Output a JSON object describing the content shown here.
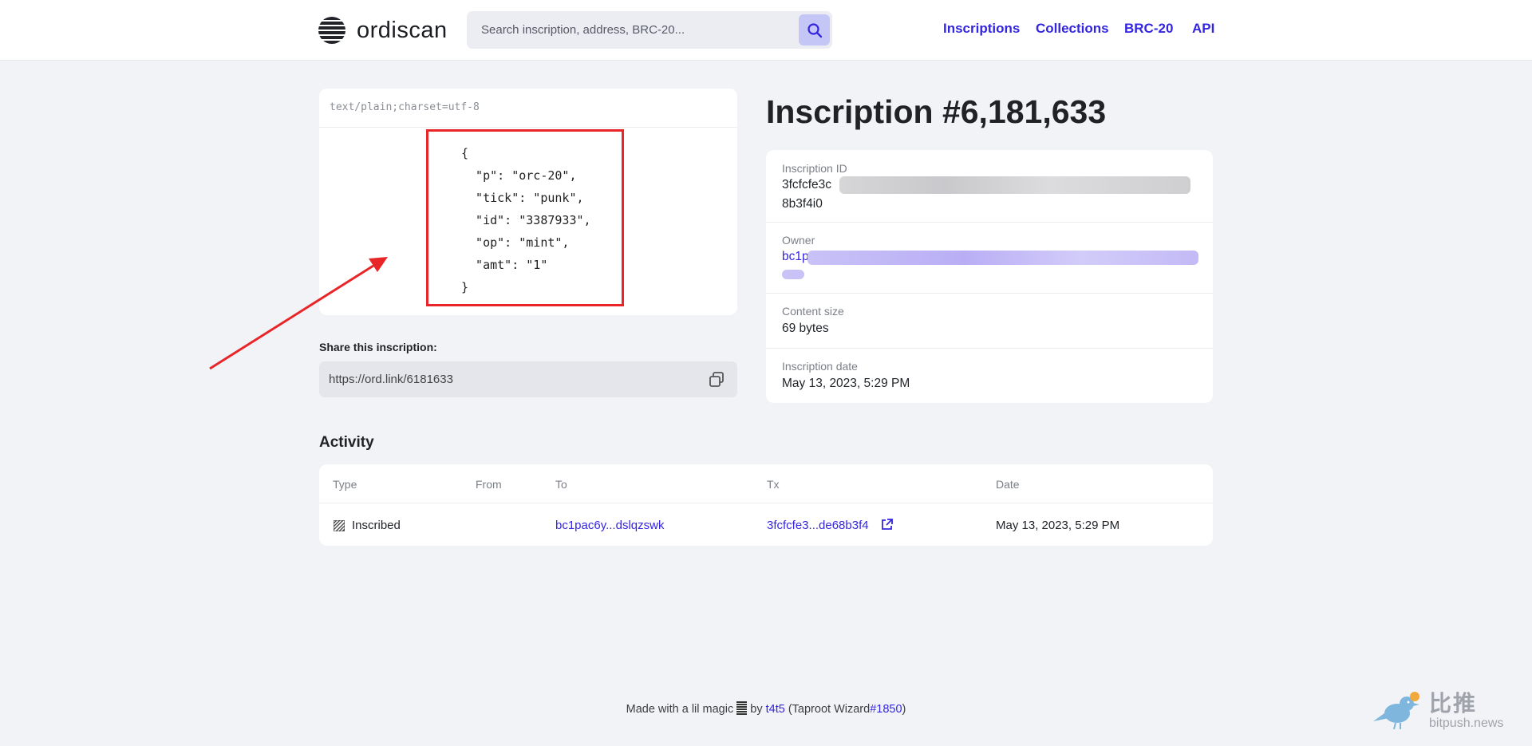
{
  "header": {
    "brand": "ordiscan",
    "search_placeholder": "Search inscription, address, BRC-20...",
    "nav": [
      {
        "label": "Inscriptions"
      },
      {
        "label": "Collections"
      },
      {
        "label": "BRC-20"
      },
      {
        "label": "API"
      }
    ]
  },
  "preview": {
    "content_type": "text/plain;charset=utf-8",
    "content": "{\n  \"p\": \"orc-20\",\n  \"tick\": \"punk\",\n  \"id\": \"3387933\",\n  \"op\": \"mint\",\n  \"amt\": \"1\"\n}"
  },
  "share": {
    "label": "Share this inscription:",
    "url": "https://ord.link/6181633"
  },
  "inscription": {
    "title": "Inscription #6,181,633",
    "details": [
      {
        "label": "Inscription ID",
        "value_start": "3fcfcfe3c",
        "value_end": "8b3f4i0"
      },
      {
        "label": "Owner",
        "value_start": "bc1p"
      },
      {
        "label": "Content size",
        "value": "69 bytes"
      },
      {
        "label": "Inscription date",
        "value": "May 13, 2023, 5:29 PM"
      }
    ]
  },
  "activity": {
    "title": "Activity",
    "columns": [
      "Type",
      "From",
      "To",
      "Tx",
      "Date"
    ],
    "rows": [
      {
        "type": "Inscribed",
        "from": "",
        "to": "bc1pac6y...dslqzswk",
        "tx": "3fcfcfe3...de68b3f4",
        "date": "May 13, 2023, 5:29 PM"
      }
    ]
  },
  "footer": {
    "prefix": "Made with a lil magic",
    "by": "by",
    "author": "t4t5",
    "paren_open": "(Taproot Wizard",
    "wizard": "#1850",
    "paren_close": ")"
  },
  "watermark": {
    "cn": "比推",
    "en": "bitpush.news"
  },
  "colors": {
    "accent": "#3426e0",
    "highlight": "#e8262a",
    "background": "#f2f3f6"
  }
}
